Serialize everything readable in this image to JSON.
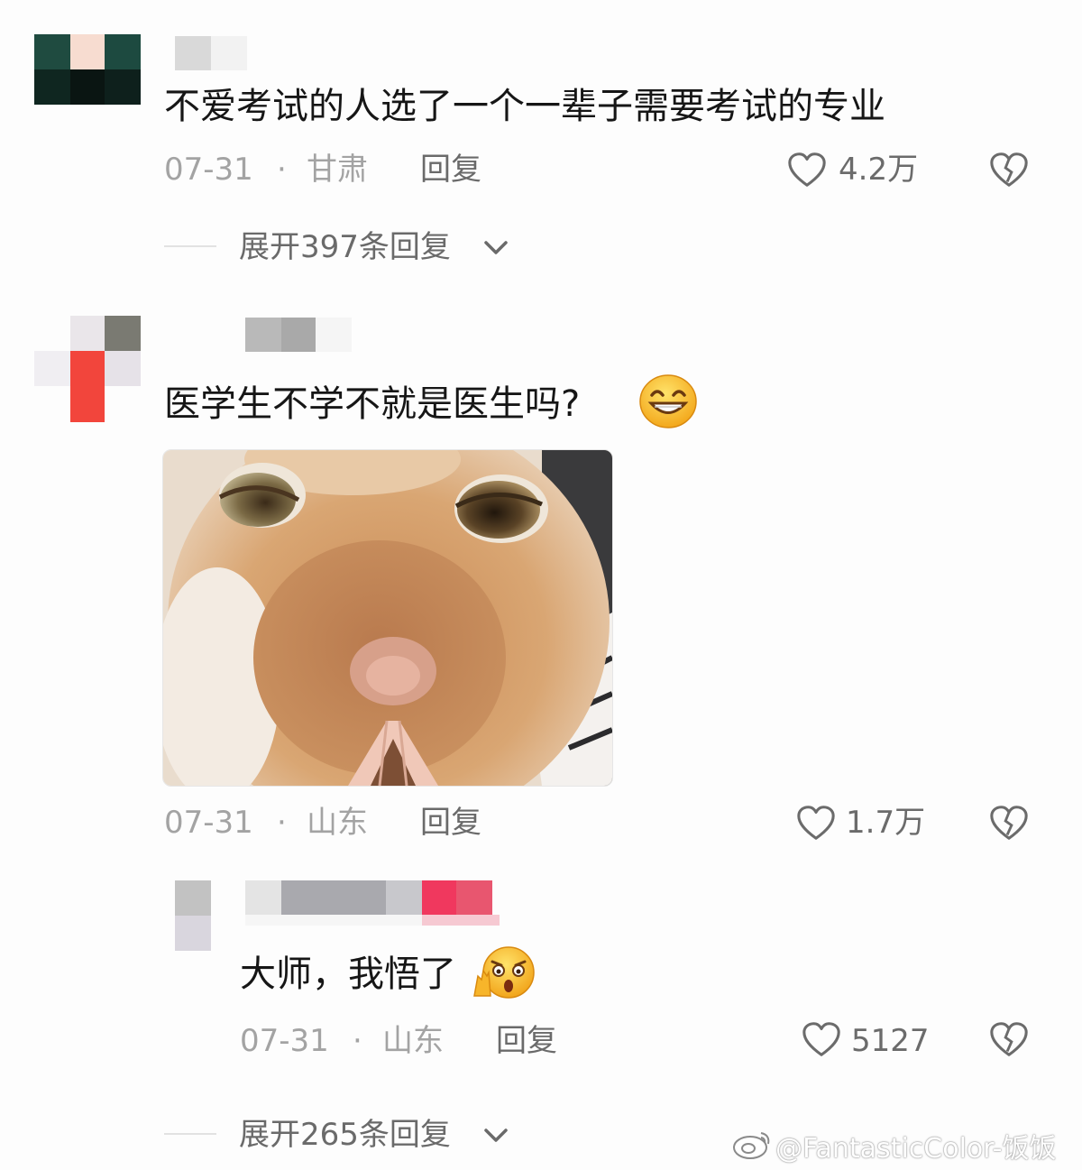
{
  "comments": [
    {
      "text": "不爱考试的人选了一个一辈子需要考试的专业",
      "date": "07-31",
      "sep": "·",
      "location": "甘肃",
      "reply_label": "回复",
      "likes": "4.2万",
      "expand": "展开397条回复"
    },
    {
      "text": "医学生不学不就是医生吗?",
      "emoji": "grinning-face-icon",
      "image": "cat-photo",
      "date": "07-31",
      "sep": "·",
      "location": "山东",
      "reply_label": "回复",
      "likes": "1.7万",
      "reply": {
        "text": "大师，我悟了",
        "emoji": "shocked-face-icon",
        "date": "07-31",
        "sep": "·",
        "location": "山东",
        "reply_label": "回复",
        "likes": "5127"
      },
      "expand": "展开265条回复"
    }
  ],
  "watermark": "@FantasticColor-饭饭",
  "colors": {
    "meta": "#a3a3a3",
    "accent_pink": "#f03a5f"
  }
}
